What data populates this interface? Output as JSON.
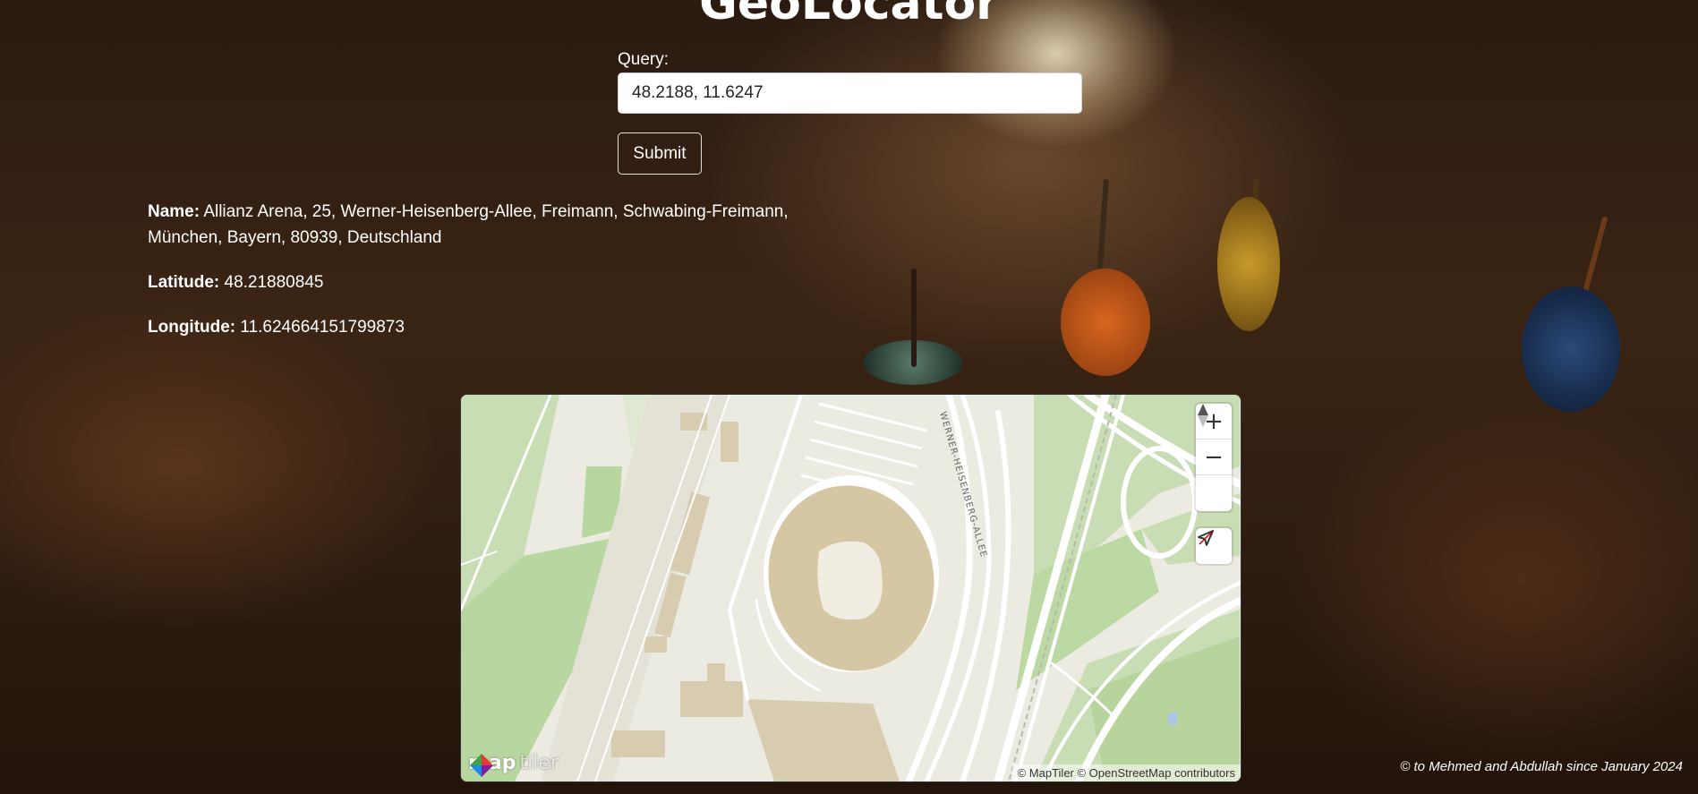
{
  "app": {
    "title": "GeoLocator"
  },
  "form": {
    "query_label": "Query:",
    "query_value": "48.2188, 11.6247",
    "submit_label": "Submit"
  },
  "result": {
    "name_label": "Name:",
    "name_value": "Allianz Arena, 25, Werner-Heisenberg-Allee, Freimann, Schwabing-Freimann, München, Bayern, 80939, Deutschland",
    "latitude_label": "Latitude:",
    "latitude_value": "48.21880845",
    "longitude_label": "Longitude:",
    "longitude_value": "11.624664151799873"
  },
  "map": {
    "street_label": "WERNER-HEISENBERG-ALLEE",
    "zoom_in_icon": "plus-icon",
    "zoom_out_icon": "minus-icon",
    "compass_icon": "compass-icon",
    "geolocate_icon": "location-arrow-icon",
    "logo_map": "map",
    "logo_tiler": "tiler",
    "attribution": "© MapTiler © OpenStreetMap contributors",
    "colors": {
      "land": "#ecebe2",
      "park": "#c8ddb4",
      "building": "#d8ccb0",
      "road": "#ffffff"
    }
  },
  "footer": {
    "credit": "© to Mehmed and Abdullah since January 2024"
  }
}
